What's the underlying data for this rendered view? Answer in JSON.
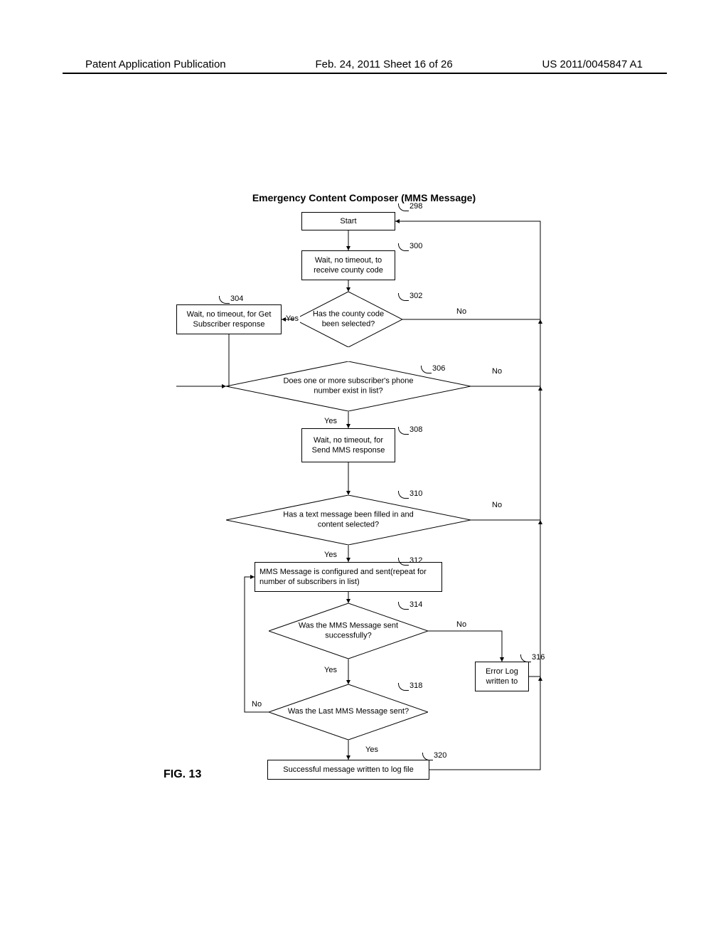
{
  "header": {
    "left": "Patent Application Publication",
    "center": "Feb. 24, 2011  Sheet 16 of 26",
    "right": "US 2011/0045847 A1"
  },
  "title": "Emergency Content Composer (MMS Message)",
  "figure_label": "FIG. 13",
  "boxes": {
    "b298": "Start",
    "b300": "Wait, no timeout, to receive county code",
    "b304": "Wait, no timeout, for Get Subscriber response",
    "b308": "Wait, no timeout, for Send MMS response",
    "b312": "MMS Message is configured and sent(repeat for number of subscribers in list)",
    "b316": "Error Log written to",
    "b320": "Successful message written to log file"
  },
  "diamonds": {
    "d302": "Has the county code been selected?",
    "d306": "Does one or more subscriber's phone number exist in list?",
    "d310": "Has a text message been filled in and content selected?",
    "d314": "Was the MMS Message sent successfully?",
    "d318": "Was the Last MMS Message sent?"
  },
  "labels": {
    "yes": "Yes",
    "no": "No"
  },
  "refs": {
    "r298": "298",
    "r300": "300",
    "r302": "302",
    "r304": "304",
    "r306": "306",
    "r308": "308",
    "r310": "310",
    "r312": "312",
    "r314": "314",
    "r316": "316",
    "r318": "318",
    "r320": "320"
  }
}
